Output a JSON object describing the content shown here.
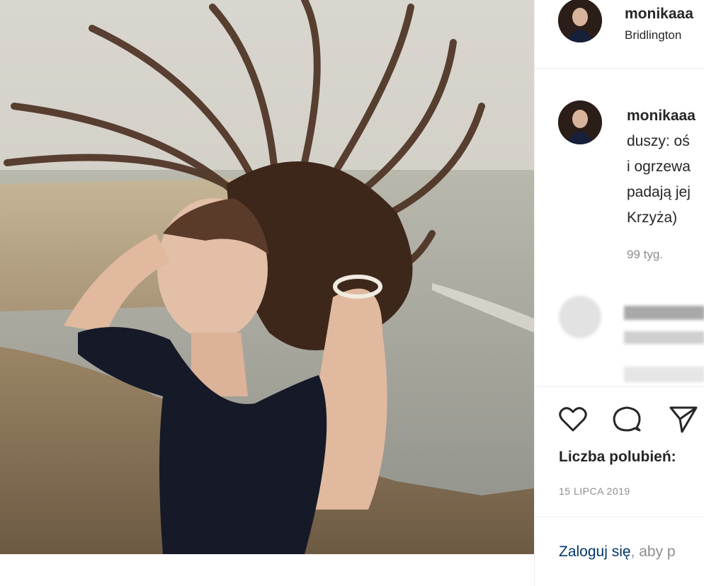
{
  "post": {
    "header": {
      "username": "monikaaa",
      "location": "Bridlington"
    },
    "caption": {
      "username": "monikaaa",
      "lines": [
        "duszy: oś",
        "i ogrzewa",
        "padają jej",
        "Krzyża)"
      ],
      "time": "99 tyg."
    },
    "actions": {
      "like_icon": "heart-icon",
      "comment_icon": "comment-icon",
      "share_icon": "send-icon"
    },
    "likes_label": "Liczba polubień:",
    "date": "15 LIPCA 2019",
    "login": {
      "link": "Zaloguj się",
      "rest": ", aby p"
    }
  },
  "colors": {
    "text": "#262626",
    "muted": "#8e8e8e",
    "link": "#00376b",
    "divider": "#efefef"
  }
}
